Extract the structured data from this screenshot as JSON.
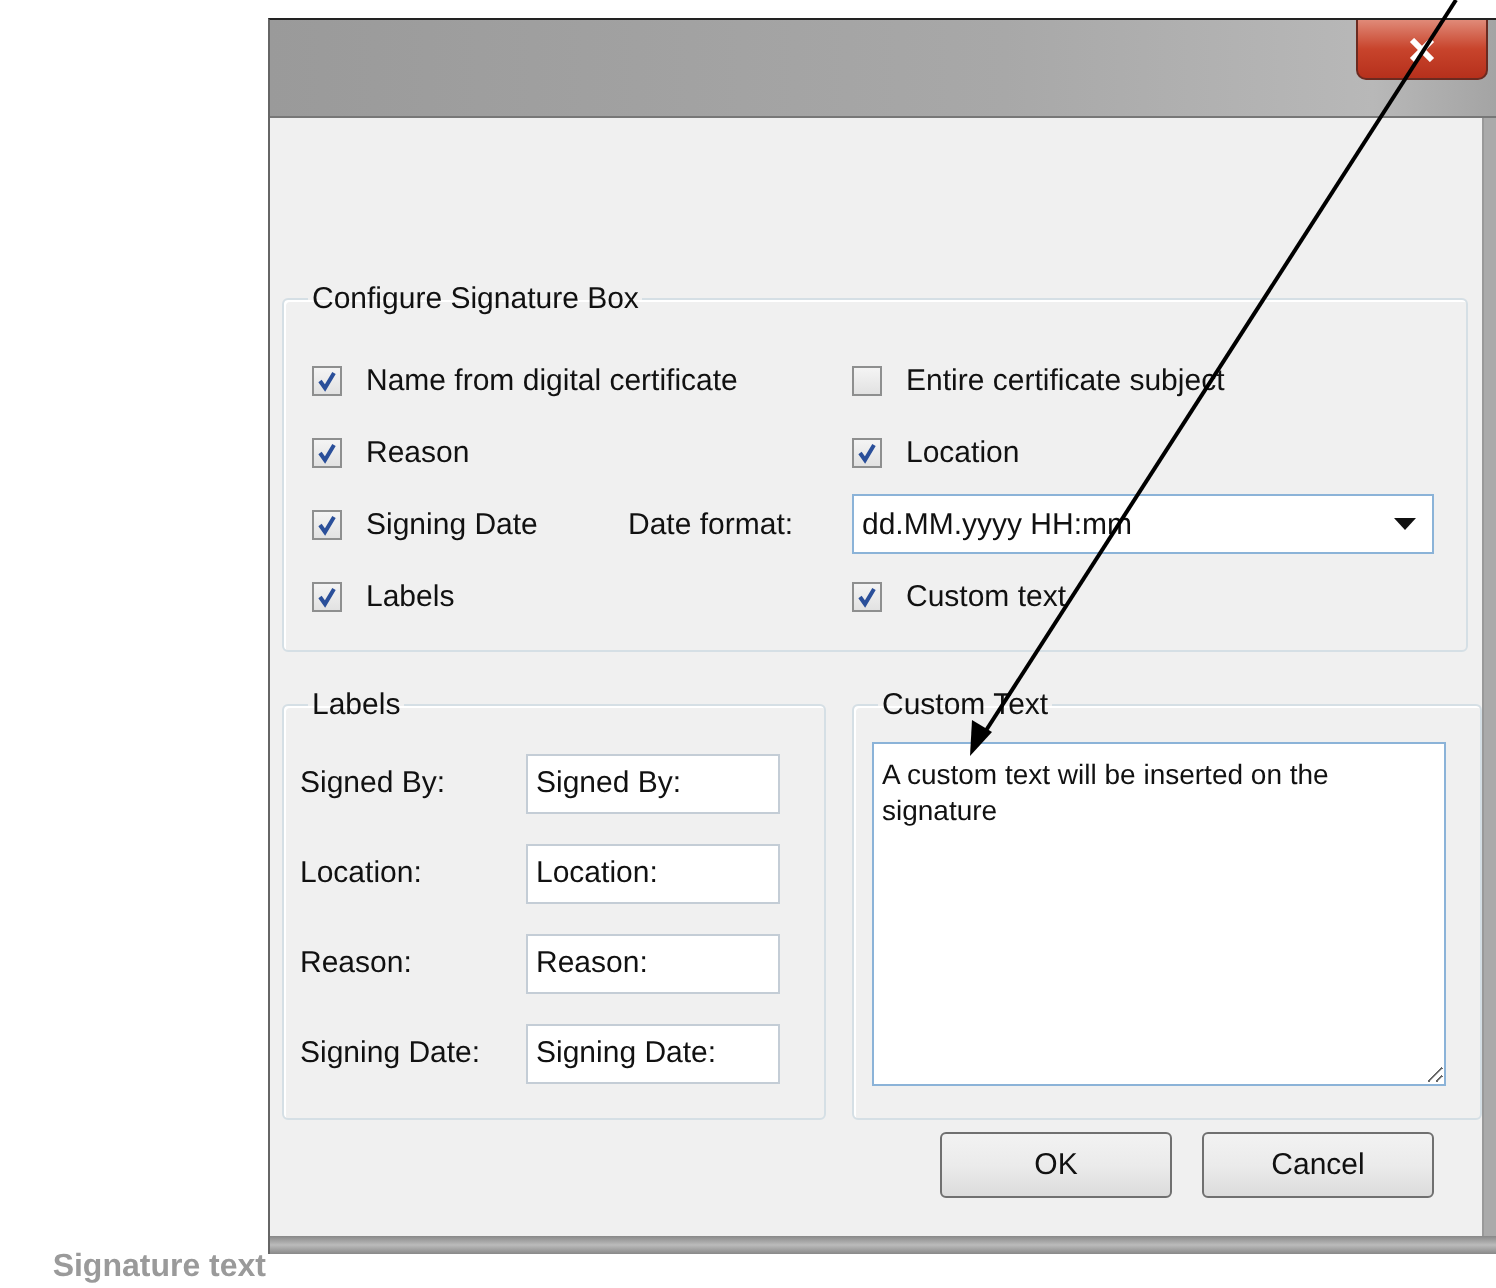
{
  "caption": "Signature text",
  "dialog": {
    "signature_box": {
      "title": "Configure Signature Box",
      "rows": [
        {
          "left": {
            "label": "Name from digital certificate",
            "checked": true
          },
          "right": {
            "label": "Entire certificate subject",
            "checked": false
          }
        },
        {
          "left": {
            "label": "Reason",
            "checked": true
          },
          "right": {
            "label": "Location",
            "checked": true
          }
        },
        {
          "left": {
            "label": "Signing Date",
            "checked": true
          },
          "date_format": {
            "label": "Date format:",
            "value": "dd.MM.yyyy HH:mm"
          }
        },
        {
          "left": {
            "label": "Labels",
            "checked": true
          },
          "right": {
            "label": "Custom text",
            "checked": true
          }
        }
      ]
    },
    "labels": {
      "title": "Labels",
      "fields": [
        {
          "label": "Signed By:",
          "value": "Signed By:"
        },
        {
          "label": "Location:",
          "value": "Location:"
        },
        {
          "label": "Reason:",
          "value": "Reason:"
        },
        {
          "label": "Signing Date:",
          "value": "Signing Date:"
        }
      ]
    },
    "custom_text": {
      "title": "Custom Text",
      "value": "A custom text will be inserted on the signature"
    },
    "buttons": [
      "OK",
      "Cancel"
    ]
  }
}
